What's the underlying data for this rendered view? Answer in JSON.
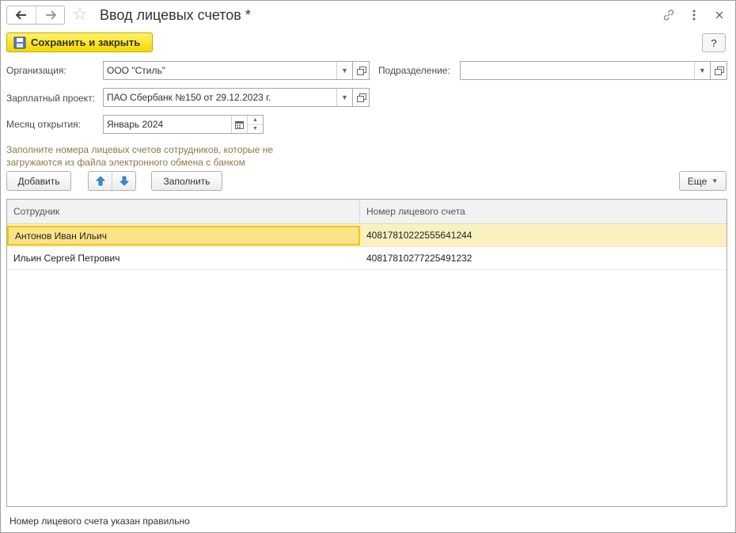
{
  "window": {
    "title": "Ввод лицевых счетов *"
  },
  "toolbar": {
    "save_close_label": "Сохранить и закрыть",
    "help_label": "?"
  },
  "form": {
    "organization": {
      "label": "Организация:",
      "value": "ООО \"Стиль\""
    },
    "department": {
      "label": "Подразделение:",
      "value": ""
    },
    "salary_project": {
      "label": "Зарплатный проект:",
      "value": "ПАО Сбербанк №150 от 29.12.2023 г."
    },
    "opening_month": {
      "label": "Месяц открытия:",
      "value": "Январь 2024"
    }
  },
  "hint_text": "Заполните номера лицевых счетов сотрудников, которые не загружаются из файла электронного обмена с банком",
  "table_toolbar": {
    "add_label": "Добавить",
    "fill_label": "Заполнить",
    "more_label": "Еще"
  },
  "table": {
    "columns": [
      "Сотрудник",
      "Номер лицевого счета"
    ],
    "rows": [
      {
        "employee": "Антонов Иван Ильич",
        "account": "40817810222555641244"
      },
      {
        "employee": "Ильин Сергей Петрович",
        "account": "40817810277225491232"
      }
    ]
  },
  "status_text": "Номер лицевого счета указан правильно",
  "colors": {
    "primary_button": "#f5d800",
    "selected_row": "#fbf1c0",
    "selected_cell_border": "#f5c500",
    "hint_text": "#8a7a47",
    "arrow_icon": "#3c8fd6"
  }
}
